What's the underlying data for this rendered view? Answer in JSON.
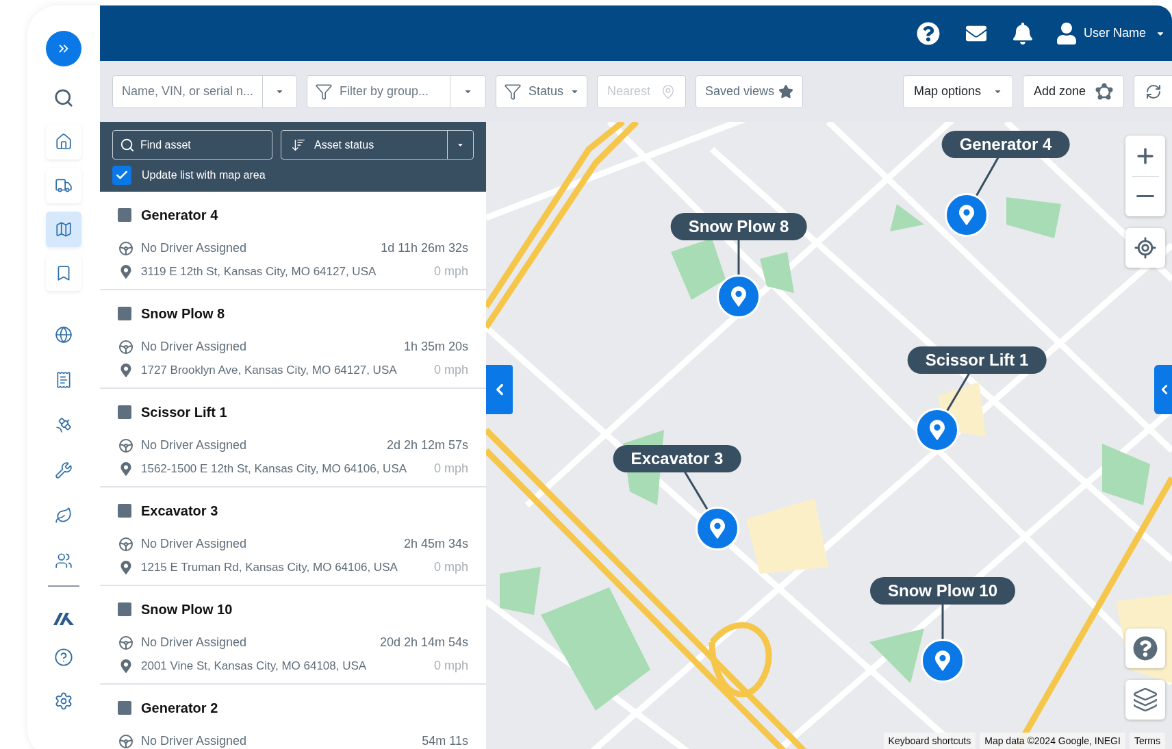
{
  "header": {
    "user_name": "User Name"
  },
  "sidebar": {
    "items": [
      {
        "kind": "card",
        "selected": false
      },
      {
        "kind": "card",
        "selected": false
      },
      {
        "kind": "card",
        "selected": true
      },
      {
        "kind": "card",
        "selected": false
      },
      {
        "kind": "plain",
        "selected": false
      },
      {
        "kind": "plain",
        "selected": false
      },
      {
        "kind": "plain",
        "selected": false
      },
      {
        "kind": "plain",
        "selected": false
      },
      {
        "kind": "plain",
        "selected": false
      },
      {
        "kind": "plain",
        "selected": false
      }
    ]
  },
  "toolbar": {
    "search": {
      "placeholder": "Name, VIN, or serial n..."
    },
    "group_filter": {
      "placeholder": "Filter by group..."
    },
    "status": "Status",
    "nearest": {
      "label": "Nearest",
      "disabled": true
    },
    "saved_views": "Saved views",
    "map_options": "Map options",
    "add_zone": "Add zone"
  },
  "list_panel": {
    "find": {
      "placeholder": "Find asset"
    },
    "sort": "Asset status",
    "update_with_map": {
      "label": "Update list with map area",
      "checked": true
    },
    "assets": [
      {
        "name": "Generator 4",
        "driver": "No Driver Assigned",
        "duration": "1d 11h 26m 32s",
        "address": "3119 E 12th St, Kansas City, MO 64127, USA",
        "speed": "0 mph"
      },
      {
        "name": "Snow Plow 8",
        "driver": "No Driver Assigned",
        "duration": "1h 35m 20s",
        "address": "1727 Brooklyn Ave, Kansas City, MO 64127, USA",
        "speed": "0 mph"
      },
      {
        "name": "Scissor Lift 1",
        "driver": "No Driver Assigned",
        "duration": "2d 2h 12m 57s",
        "address": "1562-1500 E 12th St, Kansas City, MO 64106, USA",
        "speed": "0 mph"
      },
      {
        "name": "Excavator 3",
        "driver": "No Driver Assigned",
        "duration": "2h 45m 34s",
        "address": "1215 E Truman Rd, Kansas City, MO 64106, USA",
        "speed": "0 mph"
      },
      {
        "name": "Snow Plow 10",
        "driver": "No Driver Assigned",
        "duration": "20d 2h 14m 54s",
        "address": "2001 Vine St, Kansas City, MO 64108, USA",
        "speed": "0 mph"
      },
      {
        "name": "Generator 2",
        "driver": "No Driver Assigned",
        "duration": "54m 11s"
      }
    ]
  },
  "map": {
    "markers": [
      {
        "label": "Generator 4"
      },
      {
        "label": "Snow Plow 8"
      },
      {
        "label": "Scissor Lift 1"
      },
      {
        "label": "Excavator 3"
      },
      {
        "label": "Snow Plow 10"
      }
    ],
    "attribution": [
      "Keyboard shortcuts",
      "Map data ©2024 Google, INEGI",
      "Terms"
    ]
  }
}
